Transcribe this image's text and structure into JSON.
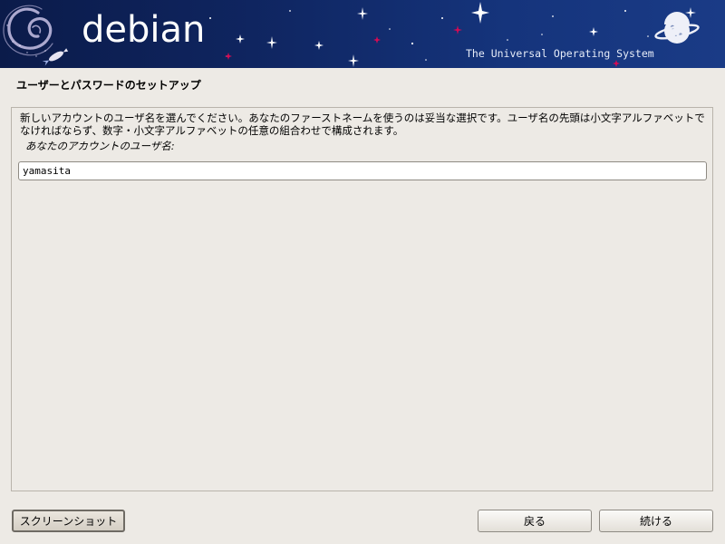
{
  "banner": {
    "logo_text": "debian",
    "tagline": "The Universal Operating System"
  },
  "page": {
    "title": "ユーザーとパスワードのセットアップ"
  },
  "form": {
    "description": "新しいアカウントのユーザ名を選んでください。あなたのファーストネームを使うのは妥当な選択です。ユーザ名の先頭は小文字アルファベットでなければならず、数字・小文字アルファベットの任意の組合わせで構成されます。",
    "field_label": "あなたのアカウントのユーザ名:",
    "username_value": "yamasita"
  },
  "buttons": {
    "screenshot_label": "スクリーンショット",
    "back_label": "戻る",
    "continue_label": "続ける"
  },
  "colors": {
    "banner_bg": "#0f2560",
    "page_bg": "#edeae5",
    "accent_red": "#d70a53"
  }
}
